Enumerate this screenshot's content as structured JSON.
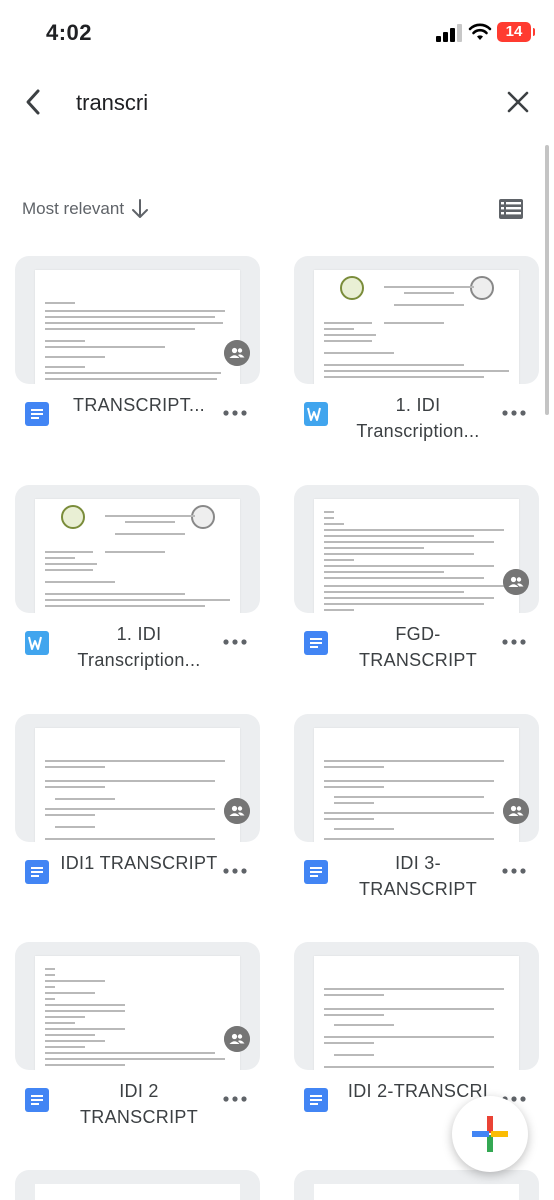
{
  "status_bar": {
    "time": "4:02",
    "battery": "14"
  },
  "search": {
    "query": "transcri"
  },
  "sort": {
    "label": "Most relevant"
  },
  "files": [
    {
      "title": "TRANSCRIPT...",
      "type": "gdoc",
      "shared": true
    },
    {
      "title": "1. IDI Transcription...",
      "type": "word",
      "shared": false
    },
    {
      "title": "1. IDI Transcription...",
      "type": "word",
      "shared": false
    },
    {
      "title": "FGD-TRANSCRIPT",
      "type": "gdoc",
      "shared": true
    },
    {
      "title": "IDI1 TRANSCRIPT",
      "type": "gdoc",
      "shared": true
    },
    {
      "title": "IDI 3-TRANSCRIPT",
      "type": "gdoc",
      "shared": true
    },
    {
      "title": "IDI 2 TRANSCRIPT",
      "type": "gdoc",
      "shared": true
    },
    {
      "title": "IDI 2-TRANSCRI",
      "type": "gdoc",
      "shared": false
    }
  ],
  "colors": {
    "gdoc": "#4285f4",
    "word": "#41a5ee",
    "badge": "#757575"
  },
  "icons": [
    "back-arrow-icon",
    "close-icon",
    "arrow-down-icon",
    "list-view-icon",
    "shared-people-icon",
    "more-vert-icon",
    "plus-icon"
  ]
}
